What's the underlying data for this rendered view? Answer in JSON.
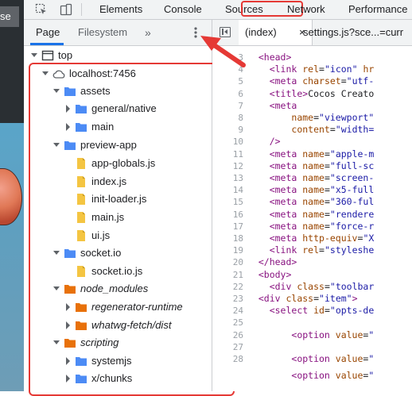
{
  "preview": {
    "button_label": "se"
  },
  "toolbar": {
    "tabs": [
      {
        "label": "Elements"
      },
      {
        "label": "Console"
      },
      {
        "label": "Sources"
      },
      {
        "label": "Network"
      },
      {
        "label": "Performance"
      }
    ]
  },
  "navigator": {
    "tabs": [
      {
        "label": "Page"
      },
      {
        "label": "Filesystem"
      }
    ],
    "more_label": "»"
  },
  "editor": {
    "open_tabs": [
      {
        "label": "(index)",
        "close": "×"
      },
      {
        "label": "settings.js?sce...=curr"
      }
    ]
  },
  "tree": [
    {
      "label": "top",
      "icon": "frame-icon",
      "expanded": true
    },
    {
      "label": "localhost:7456",
      "icon": "cloud-icon",
      "expanded": true
    },
    {
      "label": "assets",
      "icon": "folder-icon",
      "expanded": true
    },
    {
      "label": "general/native",
      "icon": "folder-icon",
      "expanded": false
    },
    {
      "label": "main",
      "icon": "folder-icon",
      "expanded": false
    },
    {
      "label": "preview-app",
      "icon": "folder-icon",
      "expanded": true
    },
    {
      "label": "app-globals.js",
      "icon": "js-file-icon"
    },
    {
      "label": "index.js",
      "icon": "js-file-icon"
    },
    {
      "label": "init-loader.js",
      "icon": "js-file-icon"
    },
    {
      "label": "main.js",
      "icon": "js-file-icon"
    },
    {
      "label": "ui.js",
      "icon": "js-file-icon"
    },
    {
      "label": "socket.io",
      "icon": "folder-icon",
      "expanded": true
    },
    {
      "label": "socket.io.js",
      "icon": "js-file-icon"
    },
    {
      "label": "node_modules",
      "icon": "orange-folder-icon",
      "expanded": true,
      "italic": true
    },
    {
      "label": "regenerator-runtime",
      "icon": "orange-folder-icon",
      "expanded": false,
      "italic": true
    },
    {
      "label": "whatwg-fetch/dist",
      "icon": "orange-folder-icon",
      "expanded": false,
      "italic": true
    },
    {
      "label": "scripting",
      "icon": "orange-folder-icon",
      "expanded": true,
      "italic": true
    },
    {
      "label": "systemjs",
      "icon": "folder-icon",
      "expanded": false
    },
    {
      "label": "x/chunks",
      "icon": "folder-icon",
      "expanded": false
    }
  ],
  "code": {
    "line_numbers": [
      "3",
      "4",
      "5",
      "6",
      "7",
      "8",
      "9",
      "10",
      "11",
      "12",
      "13",
      "14",
      "15",
      "16",
      "17",
      "18",
      "19",
      "20",
      "21",
      "22",
      "23",
      "24",
      "25",
      "26",
      "27",
      "28"
    ],
    "lines": [
      [
        {
          "t": "  <",
          "c": "tag"
        },
        {
          "t": "head",
          "c": "tag"
        },
        {
          "t": ">",
          "c": "tag"
        }
      ],
      [
        {
          "t": "    <",
          "c": "tag"
        },
        {
          "t": "link ",
          "c": "tag"
        },
        {
          "t": "rel",
          "c": "attr"
        },
        {
          "t": "=",
          "c": ""
        },
        {
          "t": "\"icon\"",
          "c": "val"
        },
        {
          "t": " hr",
          "c": "attr"
        }
      ],
      [
        {
          "t": "    <",
          "c": "tag"
        },
        {
          "t": "meta ",
          "c": "tag"
        },
        {
          "t": "charset",
          "c": "attr"
        },
        {
          "t": "=",
          "c": ""
        },
        {
          "t": "\"utf-",
          "c": "val"
        }
      ],
      [
        {
          "t": "    <",
          "c": "tag"
        },
        {
          "t": "title",
          "c": "tag"
        },
        {
          "t": ">",
          "c": "tag"
        },
        {
          "t": "Cocos Creato",
          "c": ""
        }
      ],
      [
        {
          "t": "    <",
          "c": "tag"
        },
        {
          "t": "meta",
          "c": "tag"
        }
      ],
      [
        {
          "t": "        ",
          "c": ""
        },
        {
          "t": "name",
          "c": "attr"
        },
        {
          "t": "=",
          "c": ""
        },
        {
          "t": "\"viewport\"",
          "c": "val"
        }
      ],
      [
        {
          "t": "        ",
          "c": ""
        },
        {
          "t": "content",
          "c": "attr"
        },
        {
          "t": "=",
          "c": ""
        },
        {
          "t": "\"width=",
          "c": "val"
        }
      ],
      [
        {
          "t": "    />",
          "c": "tag"
        }
      ],
      [
        {
          "t": "    <",
          "c": "tag"
        },
        {
          "t": "meta ",
          "c": "tag"
        },
        {
          "t": "name",
          "c": "attr"
        },
        {
          "t": "=",
          "c": ""
        },
        {
          "t": "\"apple-m",
          "c": "val"
        }
      ],
      [
        {
          "t": "    <",
          "c": "tag"
        },
        {
          "t": "meta ",
          "c": "tag"
        },
        {
          "t": "name",
          "c": "attr"
        },
        {
          "t": "=",
          "c": ""
        },
        {
          "t": "\"full-sc",
          "c": "val"
        }
      ],
      [
        {
          "t": "    <",
          "c": "tag"
        },
        {
          "t": "meta ",
          "c": "tag"
        },
        {
          "t": "name",
          "c": "attr"
        },
        {
          "t": "=",
          "c": ""
        },
        {
          "t": "\"screen-",
          "c": "val"
        }
      ],
      [
        {
          "t": "    <",
          "c": "tag"
        },
        {
          "t": "meta ",
          "c": "tag"
        },
        {
          "t": "name",
          "c": "attr"
        },
        {
          "t": "=",
          "c": ""
        },
        {
          "t": "\"x5-full",
          "c": "val"
        }
      ],
      [
        {
          "t": "    <",
          "c": "tag"
        },
        {
          "t": "meta ",
          "c": "tag"
        },
        {
          "t": "name",
          "c": "attr"
        },
        {
          "t": "=",
          "c": ""
        },
        {
          "t": "\"360-ful",
          "c": "val"
        }
      ],
      [
        {
          "t": "    <",
          "c": "tag"
        },
        {
          "t": "meta ",
          "c": "tag"
        },
        {
          "t": "name",
          "c": "attr"
        },
        {
          "t": "=",
          "c": ""
        },
        {
          "t": "\"rendere",
          "c": "val"
        }
      ],
      [
        {
          "t": "    <",
          "c": "tag"
        },
        {
          "t": "meta ",
          "c": "tag"
        },
        {
          "t": "name",
          "c": "attr"
        },
        {
          "t": "=",
          "c": ""
        },
        {
          "t": "\"force-r",
          "c": "val"
        }
      ],
      [
        {
          "t": "    <",
          "c": "tag"
        },
        {
          "t": "meta ",
          "c": "tag"
        },
        {
          "t": "http-equiv",
          "c": "attr"
        },
        {
          "t": "=",
          "c": ""
        },
        {
          "t": "\"X",
          "c": "val"
        }
      ],
      [
        {
          "t": "    <",
          "c": "tag"
        },
        {
          "t": "link ",
          "c": "tag"
        },
        {
          "t": "rel",
          "c": "attr"
        },
        {
          "t": "=",
          "c": ""
        },
        {
          "t": "\"styleshe",
          "c": "val"
        }
      ],
      [
        {
          "t": "  </",
          "c": "tag"
        },
        {
          "t": "head",
          "c": "tag"
        },
        {
          "t": ">",
          "c": "tag"
        }
      ],
      [
        {
          "t": "  <",
          "c": "tag"
        },
        {
          "t": "body",
          "c": "tag"
        },
        {
          "t": ">",
          "c": "tag"
        }
      ],
      [
        {
          "t": "    <",
          "c": "tag"
        },
        {
          "t": "div ",
          "c": "tag"
        },
        {
          "t": "class",
          "c": "attr"
        },
        {
          "t": "=",
          "c": ""
        },
        {
          "t": "\"toolbar",
          "c": "val"
        }
      ],
      [
        {
          "t": "  <",
          "c": "tag"
        },
        {
          "t": "div ",
          "c": "tag"
        },
        {
          "t": "class",
          "c": "attr"
        },
        {
          "t": "=",
          "c": ""
        },
        {
          "t": "\"item\"",
          "c": "val"
        },
        {
          "t": ">",
          "c": "tag"
        }
      ],
      [
        {
          "t": "    <",
          "c": "tag"
        },
        {
          "t": "select ",
          "c": "tag"
        },
        {
          "t": "id",
          "c": "attr"
        },
        {
          "t": "=",
          "c": ""
        },
        {
          "t": "\"opts-de",
          "c": "val"
        }
      ],
      [
        {
          "t": "",
          "c": ""
        }
      ],
      [
        {
          "t": "        <",
          "c": "tag"
        },
        {
          "t": "option ",
          "c": "tag"
        },
        {
          "t": "value",
          "c": "attr"
        },
        {
          "t": "=",
          "c": ""
        },
        {
          "t": "\"",
          "c": "val"
        }
      ],
      [
        {
          "t": "",
          "c": ""
        }
      ],
      [
        {
          "t": "        <",
          "c": "tag"
        },
        {
          "t": "option ",
          "c": "tag"
        },
        {
          "t": "value",
          "c": "attr"
        },
        {
          "t": "=",
          "c": ""
        },
        {
          "t": "\"",
          "c": "val"
        }
      ]
    ],
    "line_29_partial": [
      {
        "t": "        <",
        "c": "tag"
      },
      {
        "t": "option ",
        "c": "tag"
      },
      {
        "t": "value",
        "c": "attr"
      },
      {
        "t": "=",
        "c": ""
      },
      {
        "t": "\"",
        "c": "val"
      }
    ]
  },
  "colors": {
    "highlight": "#e53935",
    "folder_blue": "#4c8bf5",
    "folder_orange": "#e8710a",
    "js_file": "#f4c542"
  }
}
